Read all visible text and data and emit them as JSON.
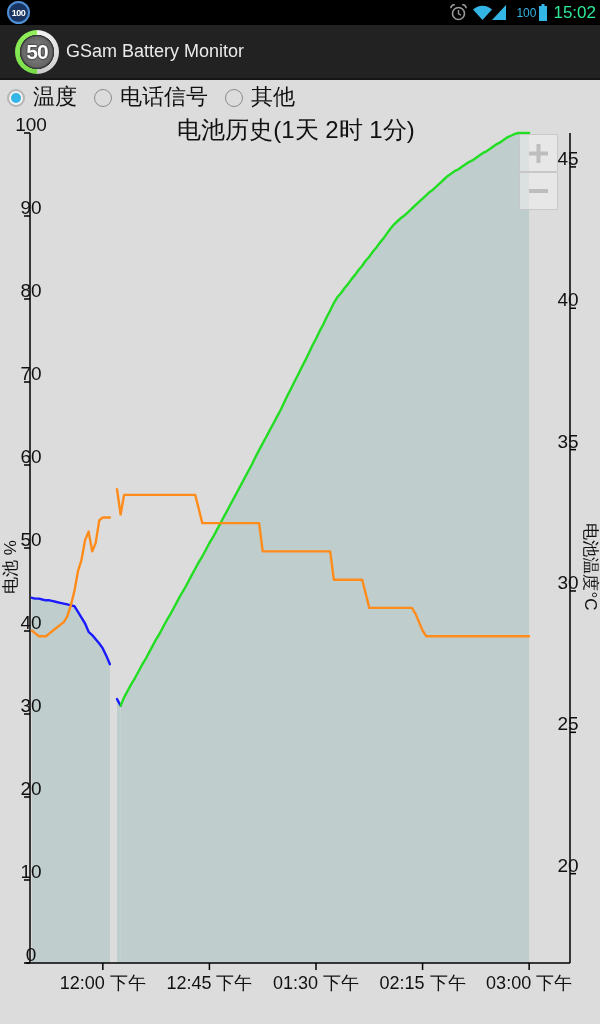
{
  "status_bar": {
    "notification": "100",
    "battery_percent": "100",
    "time": "15:02"
  },
  "app_bar": {
    "logo_text": "50",
    "title": "GSam Battery Monitor"
  },
  "options": [
    {
      "label": "温度",
      "selected": true
    },
    {
      "label": "电话信号",
      "selected": false
    },
    {
      "label": "其他",
      "selected": false
    }
  ],
  "chart": {
    "zoom_buttons": [
      {
        "kind": "zoom_in"
      },
      {
        "kind": "zoom_out"
      }
    ],
    "chart_data": {
      "type": "area",
      "title": "电池历史(1天 2时 1分)",
      "ylabel": "电池 %",
      "y2label": "电池温度°C",
      "categories": [
        null,
        null,
        null,
        null,
        null,
        null,
        null,
        null,
        null,
        null,
        null,
        null,
        null,
        null,
        null,
        null,
        null,
        null,
        null,
        null,
        "12:00 下午",
        null,
        null,
        null,
        null,
        null,
        null,
        null,
        null,
        null,
        null,
        null,
        null,
        null,
        null,
        null,
        null,
        null,
        null,
        null,
        null,
        null,
        null,
        null,
        null,
        null,
        null,
        null,
        null,
        null,
        "12:45 下午",
        null,
        null,
        null,
        null,
        null,
        null,
        null,
        null,
        null,
        null,
        null,
        null,
        null,
        null,
        null,
        null,
        null,
        null,
        null,
        null,
        null,
        null,
        null,
        null,
        null,
        null,
        null,
        null,
        null,
        "01:30 下午",
        null,
        null,
        null,
        null,
        null,
        null,
        null,
        null,
        null,
        null,
        null,
        null,
        null,
        null,
        null,
        null,
        null,
        null,
        null,
        null,
        null,
        null,
        null,
        null,
        null,
        null,
        null,
        null,
        null,
        "02:15 下午",
        null,
        null,
        null,
        null,
        null,
        null,
        null,
        null,
        null,
        null,
        null,
        null,
        null,
        null,
        null,
        null,
        null,
        null,
        null,
        null,
        null,
        null,
        null,
        null,
        null,
        null,
        null,
        null,
        null,
        "03:00 下午",
        null,
        null,
        null,
        null,
        null,
        null,
        null,
        null,
        null,
        null,
        null
      ],
      "series": [
        {
          "color": "#1a1aff",
          "values": [
            44.0,
            43.9,
            43.9,
            43.8,
            43.7,
            43.7,
            43.6,
            43.5,
            43.4,
            43.3,
            43.2,
            43.1,
            43.0,
            42.3,
            41.6,
            40.9,
            39.9,
            39.5,
            39.0,
            38.5,
            37.9,
            37.0,
            36.0,
            null,
            31.8,
            31.0,
            null,
            null,
            null,
            null,
            null,
            null,
            null,
            null,
            null,
            null,
            null,
            null,
            null,
            null,
            null,
            null,
            null,
            null,
            null,
            null,
            null,
            null,
            null,
            null,
            null,
            null,
            null,
            null,
            null,
            null,
            null,
            null,
            null,
            null,
            null,
            null,
            null,
            null,
            null,
            null,
            null,
            null,
            null,
            null,
            null,
            null,
            null,
            null,
            null,
            null,
            null,
            null,
            null,
            null,
            null,
            null,
            null,
            null,
            null,
            null,
            null,
            null,
            null,
            null,
            null,
            null,
            null,
            null,
            null,
            null,
            null,
            null,
            null,
            null,
            null,
            null,
            null,
            null,
            null,
            null,
            null,
            null,
            null,
            null,
            null,
            null,
            null,
            null,
            null,
            null,
            null,
            null,
            null,
            null,
            null,
            null,
            null,
            null,
            null,
            null,
            null,
            null,
            null,
            null,
            null,
            null,
            null,
            null,
            null,
            null,
            null,
            null,
            null,
            null,
            null,
            null,
            null,
            null,
            null,
            null,
            null,
            null,
            null,
            null,
            null,
            null
          ]
        },
        {
          "color": "#22dd22",
          "values": [
            null,
            null,
            null,
            null,
            null,
            null,
            null,
            null,
            null,
            null,
            null,
            null,
            null,
            null,
            null,
            null,
            null,
            null,
            null,
            null,
            null,
            null,
            null,
            null,
            null,
            31.0,
            32.0,
            32.8,
            33.6,
            34.3,
            35.1,
            35.9,
            36.6,
            37.4,
            38.2,
            39.0,
            39.7,
            40.5,
            41.3,
            42.0,
            42.8,
            43.6,
            44.4,
            45.1,
            45.9,
            46.7,
            47.5,
            48.3,
            49.0,
            49.8,
            50.6,
            51.3,
            52.1,
            52.9,
            53.7,
            54.5,
            55.3,
            56.1,
            56.9,
            57.7,
            58.5,
            59.3,
            60.1,
            61.0,
            61.8,
            62.6,
            63.4,
            64.2,
            65.0,
            65.8,
            66.6,
            67.5,
            68.4,
            69.2,
            70.1,
            70.9,
            71.8,
            72.6,
            73.5,
            74.4,
            75.2,
            76.1,
            76.9,
            77.8,
            78.6,
            79.5,
            80.2,
            80.7,
            81.3,
            81.8,
            82.4,
            82.9,
            83.5,
            84.0,
            84.6,
            85.1,
            85.7,
            86.2,
            86.8,
            87.3,
            87.9,
            88.5,
            89.0,
            89.4,
            89.8,
            90.1,
            90.5,
            90.9,
            91.3,
            91.7,
            92.1,
            92.5,
            92.9,
            93.2,
            93.6,
            94.0,
            94.4,
            94.8,
            95.1,
            95.4,
            95.6,
            95.9,
            96.2,
            96.5,
            96.7,
            97.0,
            97.3,
            97.6,
            97.8,
            98.1,
            98.4,
            98.7,
            98.9,
            99.2,
            99.5,
            99.7,
            99.9,
            100,
            100,
            100,
            100,
            null,
            null,
            null,
            null,
            null,
            null,
            null,
            null,
            null,
            null,
            null
          ]
        },
        {
          "color": "#ff8c1a",
          "type": "line",
          "axis": "y2",
          "values": [
            28.6,
            28.5,
            28.4,
            28.4,
            28.4,
            28.5,
            28.6,
            28.7,
            28.8,
            28.9,
            29.1,
            29.5,
            30.0,
            30.7,
            31.1,
            31.8,
            32.1,
            31.4,
            31.7,
            32.5,
            32.6,
            32.6,
            32.6,
            null,
            33.6,
            32.7,
            33.4,
            33.4,
            33.4,
            33.4,
            33.4,
            33.4,
            33.4,
            33.4,
            33.4,
            33.4,
            33.4,
            33.4,
            33.4,
            33.4,
            33.4,
            33.4,
            33.4,
            33.4,
            33.4,
            33.4,
            33.4,
            32.9,
            32.4,
            32.4,
            32.4,
            32.4,
            32.4,
            32.4,
            32.4,
            32.4,
            32.4,
            32.4,
            32.4,
            32.4,
            32.4,
            32.4,
            32.4,
            32.4,
            32.4,
            31.4,
            31.4,
            31.4,
            31.4,
            31.4,
            31.4,
            31.4,
            31.4,
            31.4,
            31.4,
            31.4,
            31.4,
            31.4,
            31.4,
            31.4,
            31.4,
            31.4,
            31.4,
            31.4,
            31.4,
            30.4,
            30.4,
            30.4,
            30.4,
            30.4,
            30.4,
            30.4,
            30.4,
            30.4,
            29.9,
            29.4,
            29.4,
            29.4,
            29.4,
            29.4,
            29.4,
            29.4,
            29.4,
            29.4,
            29.4,
            29.4,
            29.4,
            29.4,
            29.2,
            28.9,
            28.6,
            28.4,
            28.4,
            28.4,
            28.4,
            28.4,
            28.4,
            28.4,
            28.4,
            28.4,
            28.4,
            28.4,
            28.4,
            28.4,
            28.4,
            28.4,
            28.4,
            28.4,
            28.4,
            28.4,
            28.4,
            28.4,
            28.4,
            28.4,
            28.4,
            28.4,
            28.4,
            28.4,
            28.4,
            28.4,
            28.4,
            null,
            null,
            null,
            null,
            null,
            null,
            null,
            null,
            null,
            null,
            null
          ]
        }
      ],
      "ylim": [
        0,
        100
      ],
      "y2lim": [
        16.84,
        46.2
      ],
      "yticks": [
        0,
        10,
        20,
        30,
        40,
        50,
        60,
        70,
        80,
        90,
        100
      ],
      "y2ticks": [
        20,
        25,
        30,
        35,
        40,
        45
      ]
    }
  }
}
